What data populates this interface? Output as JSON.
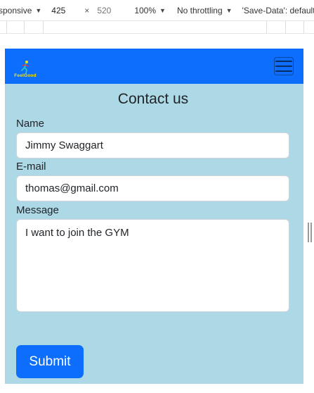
{
  "devtools": {
    "device_label": "sponsive",
    "width_value": "425",
    "height_placeholder": "520",
    "separator": "×",
    "zoom": "100%",
    "throttling": "No throttling",
    "save_data": "'Save-Data': default"
  },
  "navbar": {
    "logo_text": "FeelGood",
    "toggler_icon": "hamburger-icon"
  },
  "form": {
    "title": "Contact us",
    "name_label": "Name",
    "name_value": "Jimmy Swaggart",
    "email_label": "E-mail",
    "email_value": "thomas@gmail.com",
    "message_label": "Message",
    "message_value": "I want to join the GYM",
    "submit_label": "Submit"
  },
  "colors": {
    "navbar": "#0d6efd",
    "page_background": "#add8e6",
    "button": "#0d6efd",
    "logo_text": "#f4e20a"
  }
}
